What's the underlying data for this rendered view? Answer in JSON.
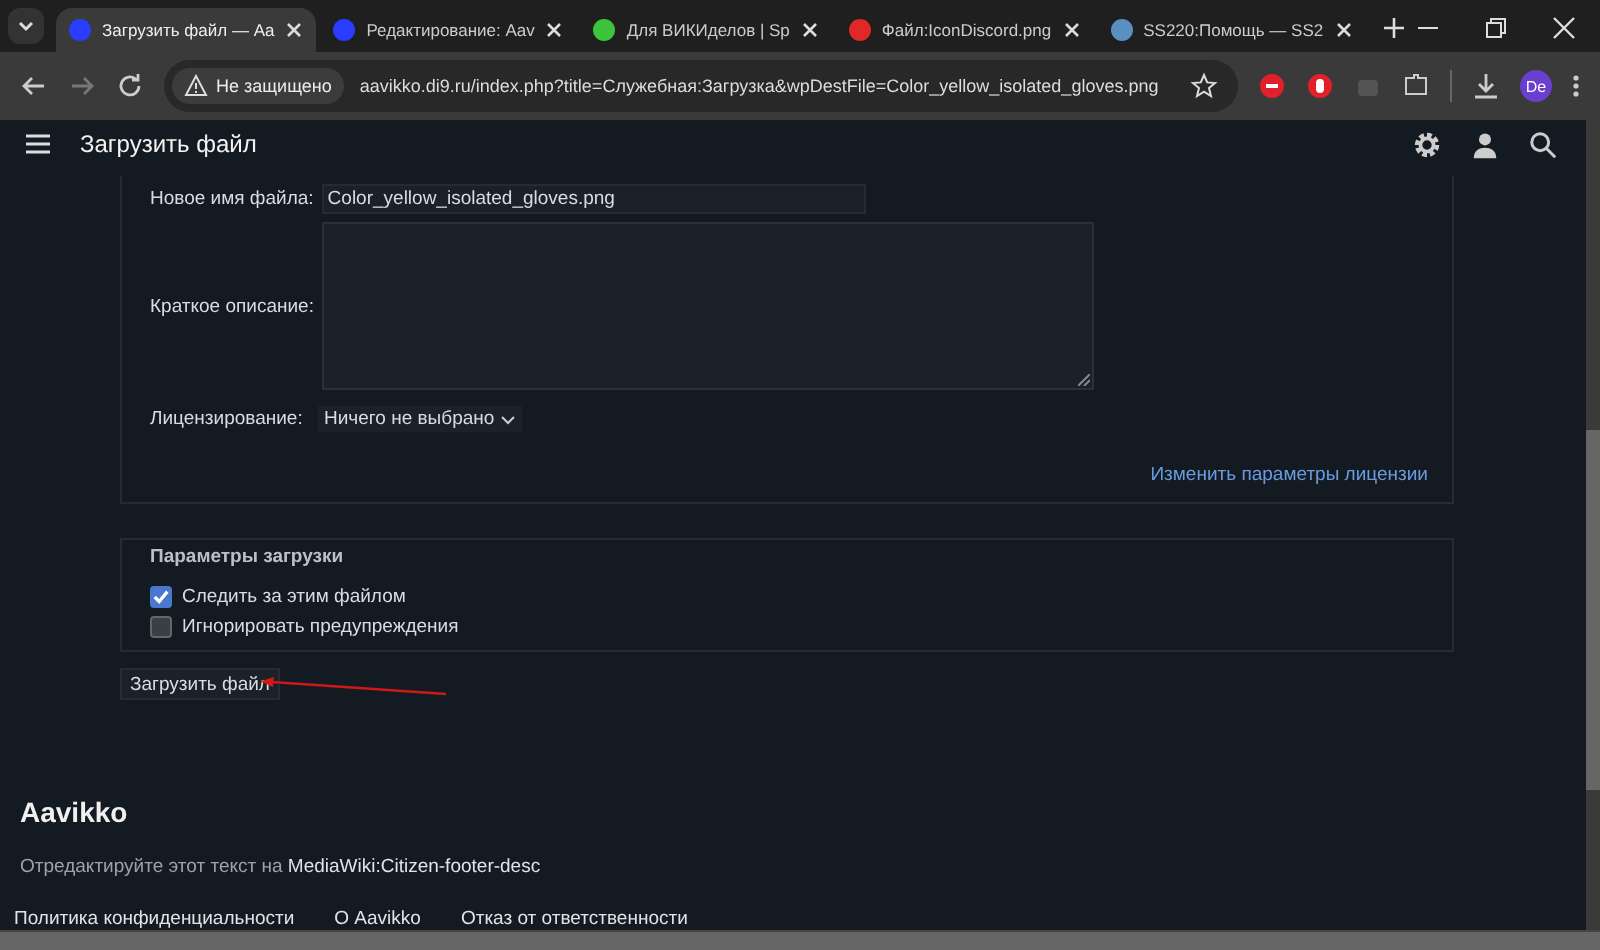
{
  "browser": {
    "tabs": [
      {
        "title": "Загрузить файл — Aa",
        "selected": true
      },
      {
        "title": "Редактирование: Aav",
        "selected": false
      },
      {
        "title": "Для ВИКИделов | Sp",
        "selected": false
      },
      {
        "title": "Файл:IconDiscord.png",
        "selected": false
      },
      {
        "title": "SS220:Помощь — SS2",
        "selected": false
      }
    ],
    "security": "Не защищено",
    "url": "aavikko.di9.ru/index.php?title=Служебная:Загрузка&wpDestFile=Color_yellow_isolated_gloves.png",
    "profile": "De"
  },
  "header": {
    "title": "Загрузить файл"
  },
  "description": {
    "fields": [
      {
        "kind": "input",
        "label": "Новое имя файла:",
        "value": "Color_yellow_isolated_gloves.png"
      },
      {
        "kind": "textarea",
        "label": "Краткое описание:"
      },
      {
        "kind": "select",
        "label": "Лицензирование:",
        "value": "Ничего не выбрано"
      }
    ],
    "license_link": "Изменить параметры лицензии"
  },
  "options": {
    "legend": "Параметры загрузки",
    "checkboxes": [
      {
        "label": "Следить за этим файлом",
        "checked": true
      },
      {
        "label": "Игнорировать предупреждения",
        "checked": false
      }
    ]
  },
  "submit": "Загрузить файл",
  "footer": {
    "site": "Aavikko",
    "desc_prefix": "Отредактируйте этот текст на",
    "desc_link": "MediaWiki:Citizen-footer-desc",
    "links": [
      "Политика конфиденциальности",
      "О Aavikko",
      "Отказ от ответственности"
    ]
  }
}
